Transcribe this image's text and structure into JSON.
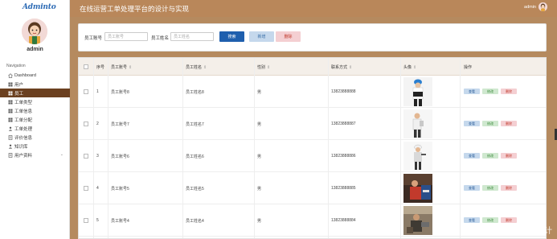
{
  "app": {
    "brand": "Adminto",
    "page_title": "在线运营工单处理平台的设计与实现"
  },
  "sidebar": {
    "user_name": "admin",
    "nav_title": "Navigation",
    "items": [
      {
        "label": "Dashboard",
        "icon": "home-icon"
      },
      {
        "label": "用户",
        "icon": "grid-icon"
      },
      {
        "label": "员工",
        "icon": "grid-icon",
        "active": true
      },
      {
        "label": "工单类型",
        "icon": "grid-icon"
      },
      {
        "label": "工单信息",
        "icon": "grid-icon"
      },
      {
        "label": "工单分配",
        "icon": "grid-icon"
      },
      {
        "label": "工单处理",
        "icon": "person-icon"
      },
      {
        "label": "评价信息",
        "icon": "doc-icon"
      },
      {
        "label": "知识库",
        "icon": "person-icon"
      },
      {
        "label": "用户资料",
        "icon": "doc-icon",
        "expandable": true
      }
    ]
  },
  "topbar": {
    "user_label": "admin"
  },
  "search": {
    "emp_no_label": "员工账号",
    "emp_no_placeholder": "员工账号",
    "emp_name_label": "员工姓名",
    "emp_name_placeholder": "员工姓名",
    "search_label": "搜索",
    "add_label": "新增",
    "delete_label": "删除"
  },
  "table": {
    "columns": [
      "序号",
      "员工账号",
      "员工姓名",
      "性别",
      "联系方式",
      "头像",
      "操作"
    ],
    "sort_glyph": "⇕",
    "op_view": "查看",
    "op_edit": "修改",
    "op_del": "删除",
    "rows": [
      {
        "index": "1",
        "account": "员工账号8",
        "name": "员工姓名8",
        "gender": "男",
        "phone": "13823888888",
        "photo": "worker-photo-1"
      },
      {
        "index": "2",
        "account": "员工账号7",
        "name": "员工姓名7",
        "gender": "男",
        "phone": "13823888887",
        "photo": "worker-photo-2"
      },
      {
        "index": "3",
        "account": "员工账号6",
        "name": "员工姓名6",
        "gender": "男",
        "phone": "13823888886",
        "photo": "worker-photo-3"
      },
      {
        "index": "4",
        "account": "员工账号5",
        "name": "员工姓名5",
        "gender": "男",
        "phone": "13823888885",
        "photo": "worker-photo-4"
      },
      {
        "index": "5",
        "account": "员工账号4",
        "name": "员工姓名4",
        "gender": "男",
        "phone": "13823888884",
        "photo": "worker-photo-5"
      }
    ]
  },
  "watermark": "CSDN @码可程序设计",
  "colors": {
    "topbar": "#b9875a",
    "active_nav": "#6b4020",
    "primary": "#1f5fae",
    "background": "#b58a5f"
  }
}
